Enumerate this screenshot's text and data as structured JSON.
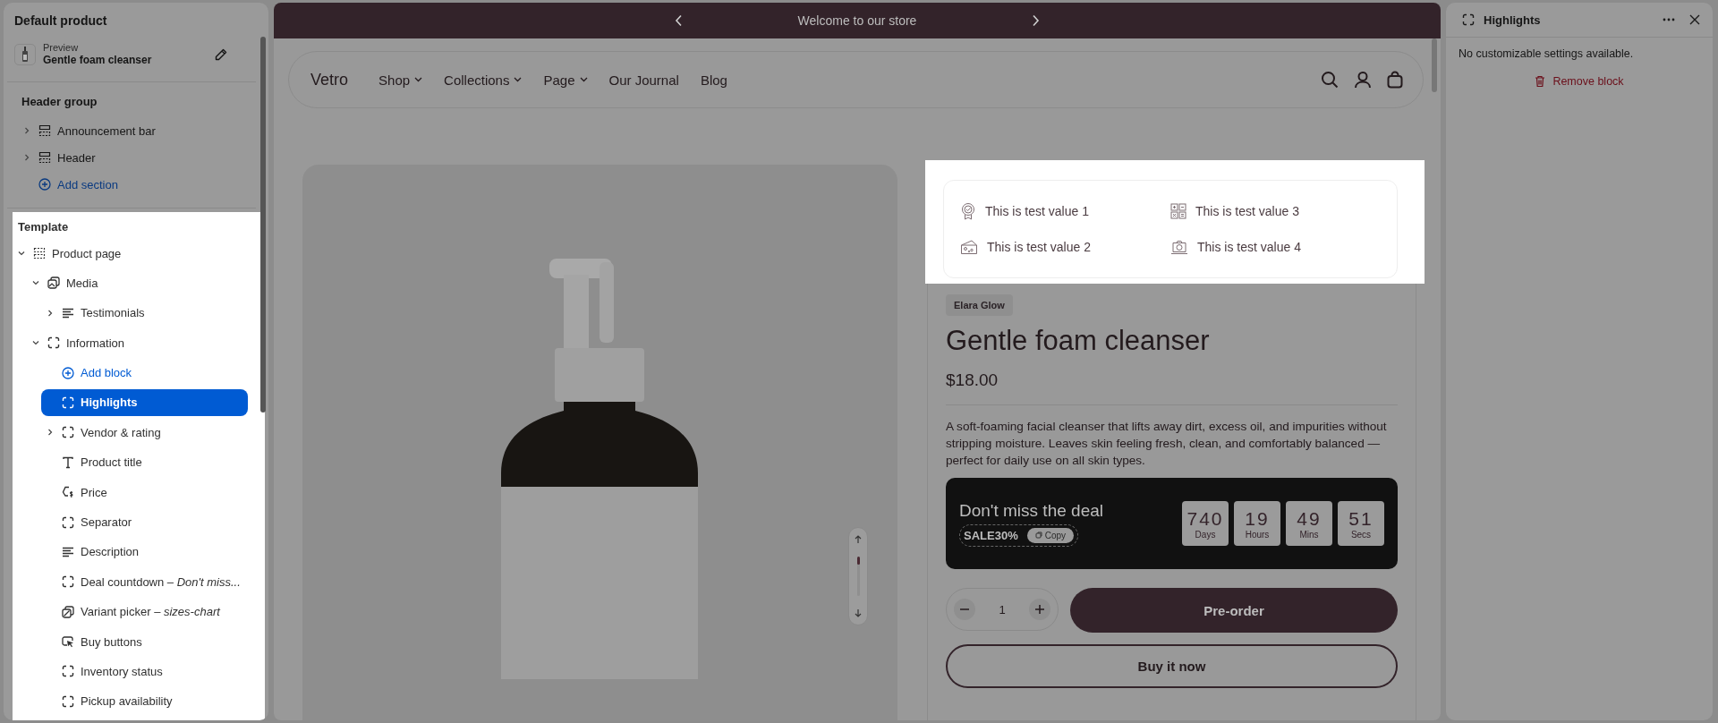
{
  "editor_sidebar": {
    "title": "Default product",
    "preview": {
      "label": "Preview",
      "product": "Gentle foam cleanser"
    },
    "header_group": {
      "title": "Header group",
      "items": [
        {
          "label": "Announcement bar",
          "kind": "section",
          "expanded": false,
          "selected": false
        },
        {
          "label": "Header",
          "kind": "section",
          "expanded": false,
          "selected": false
        },
        {
          "label": "Add section",
          "kind": "add",
          "selected": false
        }
      ]
    },
    "template": {
      "title": "Template",
      "items": [
        {
          "label": "Product page",
          "kind": "section",
          "expanded": true,
          "selected": false,
          "children": [
            {
              "label": "Media",
              "kind": "media",
              "expanded": true,
              "selected": false,
              "children": [
                {
                  "label": "Testimonials",
                  "kind": "text",
                  "expanded": false,
                  "selected": false
                }
              ]
            },
            {
              "label": "Information",
              "kind": "block",
              "expanded": true,
              "selected": false,
              "children": [
                {
                  "label": "Add block",
                  "kind": "add",
                  "selected": false
                },
                {
                  "label": "Highlights",
                  "kind": "block",
                  "selected": true
                },
                {
                  "label": "Vendor & rating",
                  "kind": "block",
                  "expanded": false,
                  "selected": false
                },
                {
                  "label": "Product title",
                  "kind": "title",
                  "selected": false
                },
                {
                  "label": "Price",
                  "kind": "price",
                  "selected": false
                },
                {
                  "label": "Separator",
                  "kind": "block",
                  "selected": false
                },
                {
                  "label": "Description",
                  "kind": "text",
                  "selected": false
                },
                {
                  "label": "Deal countdown – *Don't miss...*",
                  "kind": "block",
                  "selected": false
                },
                {
                  "label": "Variant picker – *sizes-chart*",
                  "kind": "variant",
                  "selected": false
                },
                {
                  "label": "Buy buttons",
                  "kind": "buy",
                  "selected": false
                },
                {
                  "label": "Inventory status",
                  "kind": "block",
                  "selected": false
                },
                {
                  "label": "Pickup availability",
                  "kind": "block",
                  "selected": false
                }
              ]
            }
          ]
        }
      ]
    }
  },
  "storefront": {
    "announcement": {
      "text": "Welcome to our store"
    },
    "header": {
      "logo": "Vetro",
      "nav": [
        {
          "label": "Shop",
          "dropdown": true
        },
        {
          "label": "Collections",
          "dropdown": true
        },
        {
          "label": "Page",
          "dropdown": true
        },
        {
          "label": "Our Journal",
          "dropdown": false
        },
        {
          "label": "Blog",
          "dropdown": false
        }
      ]
    },
    "product": {
      "highlights": [
        {
          "text": "This is test value 1"
        },
        {
          "text": "This is test value 2"
        },
        {
          "text": "This is test value 3"
        },
        {
          "text": "This is test value 4"
        }
      ],
      "vendor": "Elara Glow",
      "title": "Gentle foam cleanser",
      "price": "$18.00",
      "description": "A soft-foaming facial cleanser that lifts away dirt, excess oil, and impurities without stripping moisture. Leaves skin feeling fresh, clean, and comfortably balanced — perfect for daily use on all skin types.",
      "deal": {
        "title": "Don't miss the deal",
        "code": "SALE30%",
        "copy": "Copy",
        "countdown": [
          {
            "value": "740",
            "unit": "Days"
          },
          {
            "value": "19",
            "unit": "Hours"
          },
          {
            "value": "49",
            "unit": "Mins"
          },
          {
            "value": "51",
            "unit": "Secs"
          }
        ]
      },
      "quantity": "1",
      "preorder": "Pre-order",
      "buy_now": "Buy it now"
    }
  },
  "settings_panel": {
    "title": "Highlights",
    "message": "No customizable settings available.",
    "remove": "Remove block"
  }
}
